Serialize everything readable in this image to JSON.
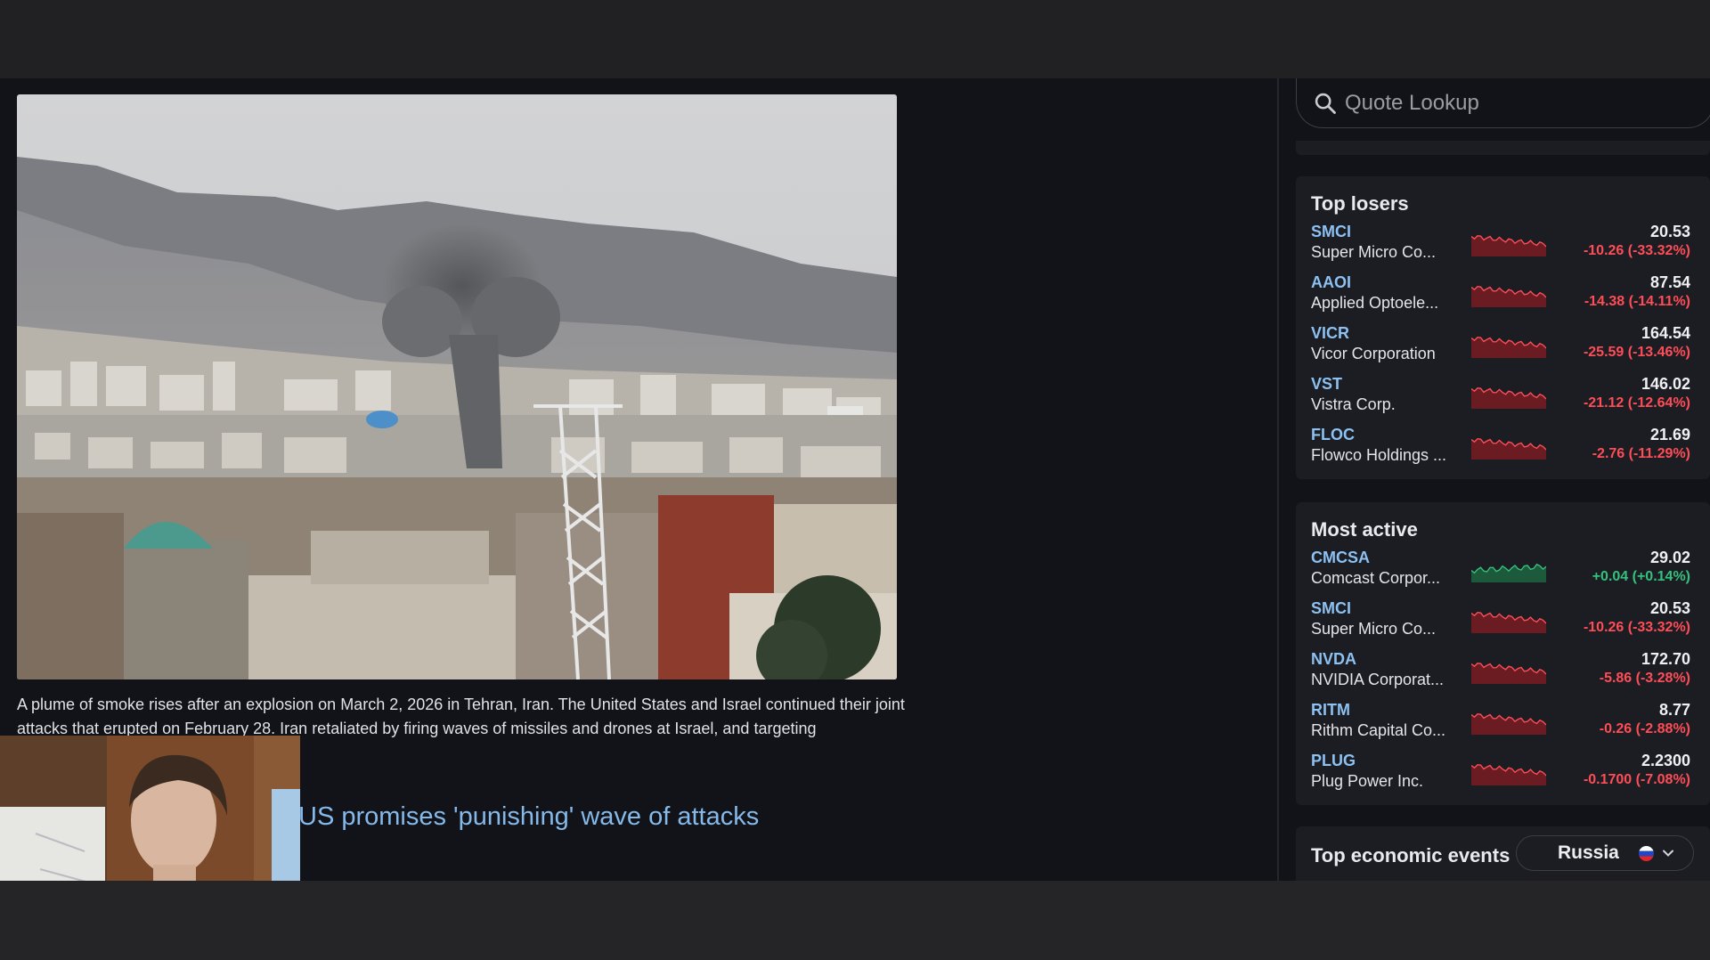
{
  "article": {
    "caption": "A plume of smoke rises after an explosion on March 2, 2026 in Tehran, Iran. The United States and Israel continued their joint attacks that erupted on February 28. Iran retaliated by firing waves of missiles and drones at Israel, and targeting",
    "headline": "US promises 'punishing' wave of attacks"
  },
  "search": {
    "placeholder": "Quote Lookup",
    "icon": "search-icon"
  },
  "top_losers": {
    "title": "Top losers",
    "rows": [
      {
        "symbol": "SMCI",
        "name": "Super Micro Co...",
        "price": "20.53",
        "change": "-10.26 (-33.32%)",
        "trend": "down"
      },
      {
        "symbol": "AAOI",
        "name": "Applied Optoele...",
        "price": "87.54",
        "change": "-14.38 (-14.11%)",
        "trend": "down"
      },
      {
        "symbol": "VICR",
        "name": "Vicor Corporation",
        "price": "164.54",
        "change": "-25.59 (-13.46%)",
        "trend": "down"
      },
      {
        "symbol": "VST",
        "name": "Vistra Corp.",
        "price": "146.02",
        "change": "-21.12 (-12.64%)",
        "trend": "down"
      },
      {
        "symbol": "FLOC",
        "name": "Flowco Holdings ...",
        "price": "21.69",
        "change": "-2.76 (-11.29%)",
        "trend": "down"
      }
    ]
  },
  "most_active": {
    "title": "Most active",
    "rows": [
      {
        "symbol": "CMCSA",
        "name": "Comcast Corpor...",
        "price": "29.02",
        "change": "+0.04 (+0.14%)",
        "trend": "up"
      },
      {
        "symbol": "SMCI",
        "name": "Super Micro Co...",
        "price": "20.53",
        "change": "-10.26 (-33.32%)",
        "trend": "down"
      },
      {
        "symbol": "NVDA",
        "name": "NVIDIA Corporat...",
        "price": "172.70",
        "change": "-5.86 (-3.28%)",
        "trend": "down"
      },
      {
        "symbol": "RITM",
        "name": "Rithm Capital Co...",
        "price": "8.77",
        "change": "-0.26 (-2.88%)",
        "trend": "down"
      },
      {
        "symbol": "PLUG",
        "name": "Plug Power Inc.",
        "price": "2.2300",
        "change": "-0.1700 (-7.08%)",
        "trend": "down"
      }
    ]
  },
  "economic_events": {
    "title": "Top economic events",
    "country": "Russia",
    "flag_icon": "russia-flag-icon"
  },
  "colors": {
    "accent_link": "#8cc1f2",
    "negative": "#ff4d57",
    "positive": "#35c07e",
    "background": "#111318",
    "card": "#1b1d22"
  }
}
